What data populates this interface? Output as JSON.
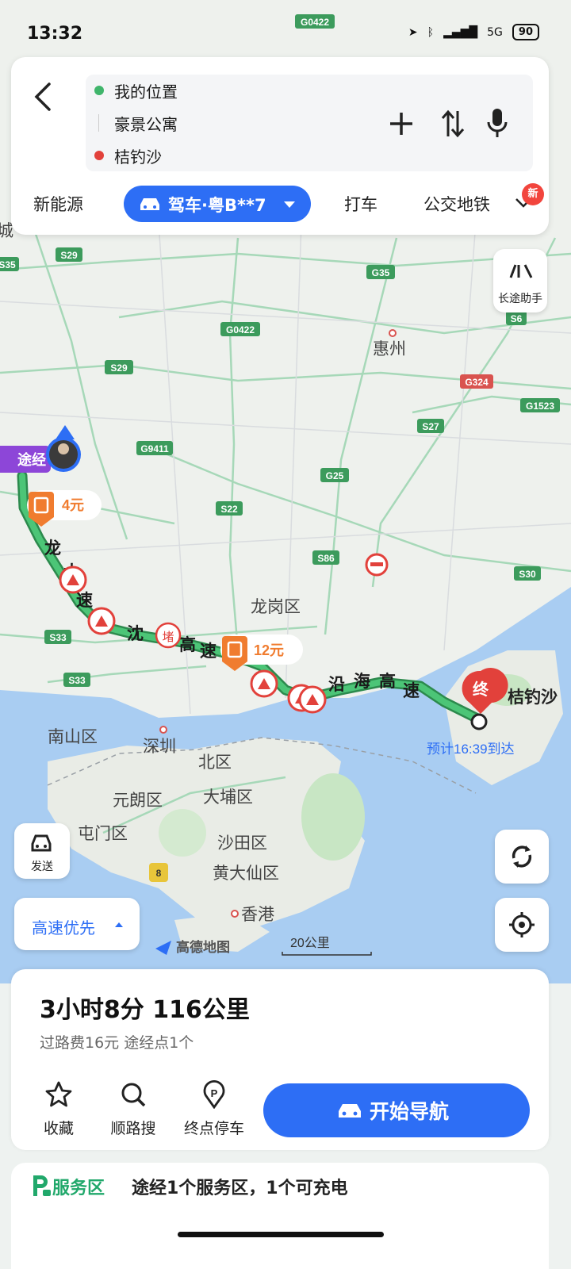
{
  "status_bar": {
    "time": "13:32",
    "network": "5G",
    "battery": "90"
  },
  "search": {
    "origin": "我的位置",
    "waypoint": "豪景公寓",
    "destination": "桔钓沙"
  },
  "modes": {
    "new_energy": "新能源",
    "drive": "驾车·粤B**7",
    "taxi": "打车",
    "transit": "公交地铁",
    "new_badge": "新"
  },
  "side": {
    "long_trip": "长途助手",
    "send": "发送"
  },
  "map": {
    "roads": {
      "g0422_top": "G0422",
      "s29_a": "S29",
      "s35": "S35",
      "g35": "G35",
      "g0422": "G0422",
      "s6": "S6",
      "s29_b": "S29",
      "g324": "G324",
      "g1523": "G1523",
      "s27": "S27",
      "g9411": "G9411",
      "g25": "G25",
      "s22": "S22",
      "s86": "S86",
      "s30": "S30",
      "s33_a": "S33",
      "s33_b": "S33",
      "r8": "8"
    },
    "places": {
      "huizhou": "惠州",
      "longgang": "龙岗区",
      "nanshan": "南山区",
      "shenzhen": "深圳",
      "north": "北区",
      "yuanlang": "元朗区",
      "dapu": "大埔区",
      "tunmen": "屯门区",
      "shatian": "沙田区",
      "huangdaxian": "黄大仙区",
      "hongkong": "香港",
      "dest_label": "桔钓沙"
    },
    "route_labels": {
      "longda": [
        "龙",
        "大",
        "速"
      ],
      "yanjiang": [
        "沈",
        "高",
        "速"
      ],
      "yanhai": [
        "沿",
        "海",
        "高",
        "速"
      ]
    },
    "waypoint_tag": "途经",
    "toll1": "4元",
    "toll2": "12元",
    "congestion": "堵",
    "dest_marker": "终",
    "eta": "预计16:39到达",
    "logo": "高德地图",
    "scale": "20公里",
    "edge_left": "城"
  },
  "preference": "高速优先",
  "route": {
    "summary": "3小时8分  116公里",
    "detail": "过路费16元  途经点1个",
    "collect": "收藏",
    "along_search": "顺路搜",
    "dest_parking": "终点停车",
    "start_nav": "开始导航"
  },
  "service": {
    "title": "服务区",
    "desc": "途经1个服务区，1个可充电"
  },
  "colors": {
    "accent": "#2d6ef5",
    "route": "#3fb56b",
    "toll": "#f07c2f",
    "danger": "#e2413b"
  }
}
